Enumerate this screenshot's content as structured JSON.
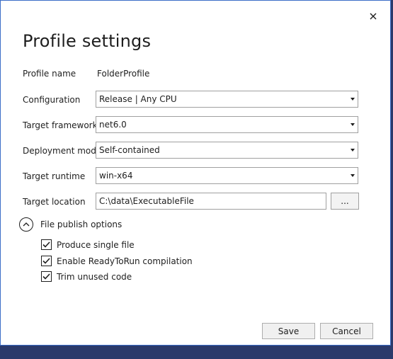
{
  "dialog": {
    "title": "Profile settings",
    "close_icon": "close-icon"
  },
  "fields": {
    "profile_name_label": "Profile name",
    "profile_name_value": "FolderProfile",
    "configuration_label": "Configuration",
    "configuration_value": "Release | Any CPU",
    "target_framework_label": "Target framework",
    "target_framework_value": "net6.0",
    "deployment_mode_label": "Deployment mode",
    "deployment_mode_value": "Self-contained",
    "target_runtime_label": "Target runtime",
    "target_runtime_value": "win-x64",
    "target_location_label": "Target location",
    "target_location_value": "C:\\data\\ExecutableFile",
    "browse_label": "..."
  },
  "publish_options": {
    "header": "File publish options",
    "expanded": true,
    "options": [
      {
        "label": "Produce single file",
        "checked": true
      },
      {
        "label": "Enable ReadyToRun compilation",
        "checked": true
      },
      {
        "label": "Trim unused code",
        "checked": true
      }
    ]
  },
  "buttons": {
    "save": "Save",
    "cancel": "Cancel"
  }
}
